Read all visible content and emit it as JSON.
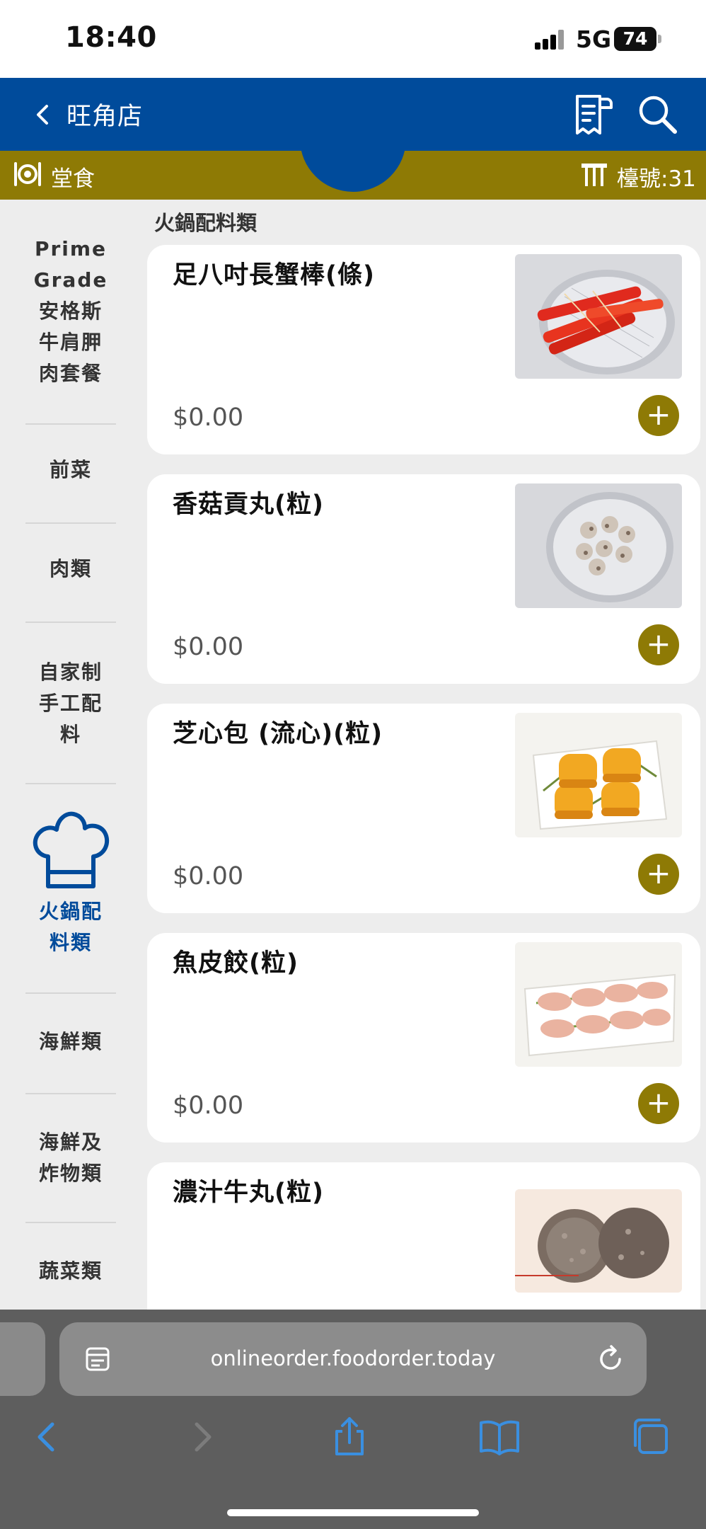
{
  "status_bar": {
    "time": "18:40",
    "network": "5G",
    "battery": "74"
  },
  "header": {
    "title": "旺角店"
  },
  "dine_bar": {
    "mode": "堂食",
    "table": "檯號:31"
  },
  "sidebar": {
    "items": [
      {
        "label": "Prime Grade 安格斯牛肩胛肉套餐",
        "lines": [
          "Prime",
          "Grade",
          "安格斯",
          "牛肩胛",
          "肉套餐"
        ]
      },
      {
        "label": "前菜"
      },
      {
        "label": "肉類"
      },
      {
        "label": "自家制手工配料",
        "lines": [
          "自家制",
          "手工配",
          "料"
        ]
      },
      {
        "label": "火鍋配料類",
        "lines": [
          "火鍋配",
          "料類"
        ],
        "active": true
      },
      {
        "label": "海鮮類"
      },
      {
        "label": "海鮮及炸物類",
        "lines": [
          "海鮮及",
          "炸物類"
        ]
      },
      {
        "label": "蔬菜類"
      }
    ]
  },
  "main": {
    "section_title": "火鍋配料類",
    "items": [
      {
        "name": "足八吋長蟹棒(條)",
        "price": "$0.00",
        "image": "crab-sticks-photo"
      },
      {
        "name": "香菇貢丸(粒)",
        "price": "$0.00",
        "image": "mushroom-balls-photo"
      },
      {
        "name": "芝心包 (流心)(粒)",
        "price": "$0.00",
        "image": "cheese-buns-photo"
      },
      {
        "name": "魚皮餃(粒)",
        "price": "$0.00",
        "image": "fish-dumplings-photo"
      },
      {
        "name": "濃汁牛丸(粒)",
        "price": "",
        "image": "beef-balls-photo"
      }
    ],
    "add_symbol": "+"
  },
  "browser": {
    "url": "onlineorder.foodorder.today"
  },
  "colors": {
    "brand_blue": "#004b9b",
    "brand_gold": "#8e7a05",
    "toolbar_blue": "#3a8fe0"
  }
}
